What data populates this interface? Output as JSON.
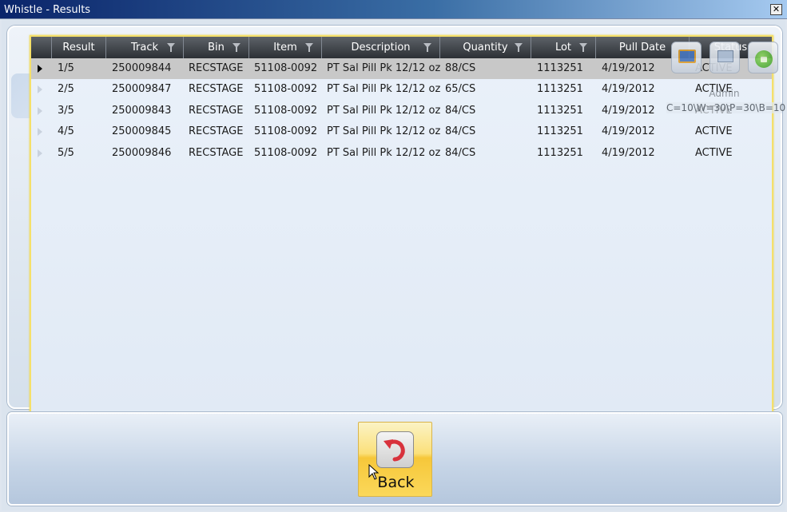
{
  "window": {
    "title": "Whistle - Results",
    "close_glyph": "✕"
  },
  "grid": {
    "columns": [
      {
        "label": "Result",
        "filter": false
      },
      {
        "label": "Track",
        "filter": true
      },
      {
        "label": "Bin",
        "filter": true
      },
      {
        "label": "Item",
        "filter": true
      },
      {
        "label": "Description",
        "filter": true
      },
      {
        "label": "Quantity",
        "filter": true
      },
      {
        "label": "Lot",
        "filter": true
      },
      {
        "label": "Pull Date",
        "filter": false
      },
      {
        "label": "Status",
        "filter": false
      }
    ],
    "rows": [
      {
        "result": "1/5",
        "track": "250009844",
        "bin": "RECSTAGE",
        "item": "51108-0092",
        "description": "PT Sal Pill Pk 12/12 oz",
        "quantity": "88/CS",
        "lot": "1113251",
        "pull_date": "4/19/2012",
        "status": "ACTIVE",
        "selected": true
      },
      {
        "result": "2/5",
        "track": "250009847",
        "bin": "RECSTAGE",
        "item": "51108-0092",
        "description": "PT Sal Pill Pk 12/12 oz",
        "quantity": "65/CS",
        "lot": "1113251",
        "pull_date": "4/19/2012",
        "status": "ACTIVE",
        "selected": false
      },
      {
        "result": "3/5",
        "track": "250009843",
        "bin": "RECSTAGE",
        "item": "51108-0092",
        "description": "PT Sal Pill Pk 12/12 oz",
        "quantity": "84/CS",
        "lot": "1113251",
        "pull_date": "4/19/2012",
        "status": "ACTIVE",
        "selected": false
      },
      {
        "result": "4/5",
        "track": "250009845",
        "bin": "RECSTAGE",
        "item": "51108-0092",
        "description": "PT Sal Pill Pk 12/12 oz",
        "quantity": "84/CS",
        "lot": "1113251",
        "pull_date": "4/19/2012",
        "status": "ACTIVE",
        "selected": false
      },
      {
        "result": "5/5",
        "track": "250009846",
        "bin": "RECSTAGE",
        "item": "51108-0092",
        "description": "PT Sal Pill Pk 12/12 oz",
        "quantity": "84/CS",
        "lot": "1113251",
        "pull_date": "4/19/2012",
        "status": "ACTIVE",
        "selected": false
      }
    ]
  },
  "overlay": {
    "user": "Admin",
    "counts": "C=10\\W=30\\P=30\\B=10",
    "icons": [
      "monitor-icon",
      "screen-icon",
      "lock-icon"
    ]
  },
  "footer": {
    "back_label": "Back",
    "back_icon": "undo-arrow-icon"
  },
  "colors": {
    "accent_yellow": "#f5e06a",
    "header_dark": "#2c3035",
    "selected_row": "#c8c8c8"
  }
}
